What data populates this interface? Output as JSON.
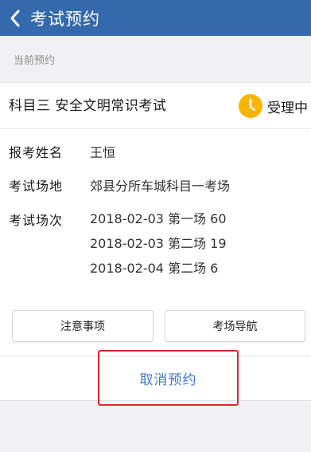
{
  "header": {
    "title": "考试预约",
    "back_icon": "chevron-left-icon"
  },
  "section": {
    "label": "当前预约"
  },
  "appointment": {
    "subject": "科目三 安全文明常识考试",
    "status": "受理中",
    "status_icon": "clock-icon",
    "status_color": "#f7b500",
    "name_label": "报考姓名",
    "name_value": "王恒",
    "venue_label": "考试场地",
    "venue_value": "郊县分所车城科目一考场",
    "session_label": "考试场次",
    "sessions": [
      "2018-02-03 第一场 60",
      "2018-02-03 第二场 19",
      "2018-02-04 第二场 6"
    ]
  },
  "actions": {
    "notes_label": "注意事项",
    "navigation_label": "考场导航",
    "cancel_label": "取消预约",
    "cancel_color": "#3b7ad0",
    "highlight_color": "#e0252b"
  },
  "theme": {
    "header_color": "#3569ad"
  }
}
